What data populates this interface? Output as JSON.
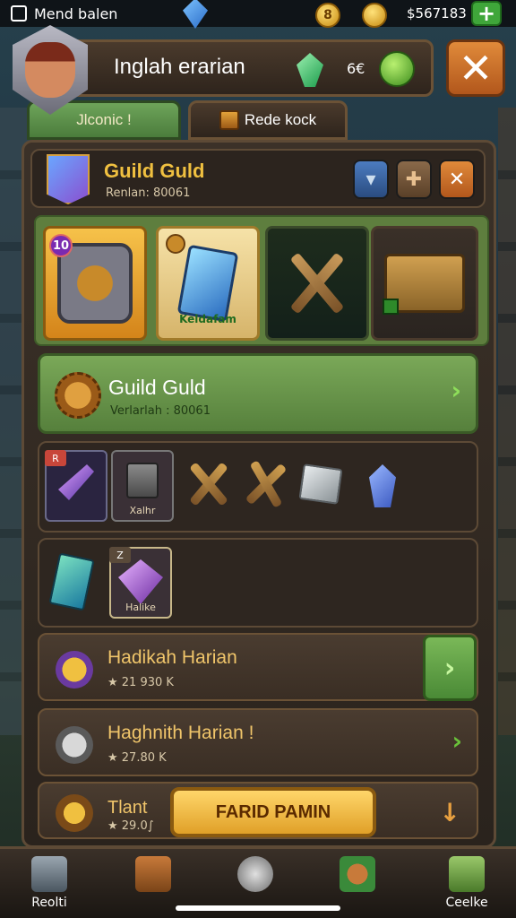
{
  "status_bar": {
    "app_name": "Mend balen",
    "coin_label": "8",
    "money": "$567183"
  },
  "header": {
    "title": "Inglah erarian",
    "count": "6€"
  },
  "tabs": [
    {
      "label": "Jlconic !"
    },
    {
      "label": "Rede kock"
    }
  ],
  "guild_header": {
    "name": "Guild Guld",
    "subtitle": "Renlan: 80061"
  },
  "cards": [
    {
      "icon": "shield-icon",
      "badge": "10"
    },
    {
      "icon": "blue-card-icon",
      "label": "Keldafam"
    },
    {
      "icon": "crossed-weapons-icon"
    },
    {
      "icon": "crate-icon"
    }
  ],
  "guild_bar": {
    "name": "Guild Guld",
    "subtitle": "Verlarlah : 80061"
  },
  "item_row_1": {
    "tag": "R",
    "slot2_label": "Xalhr"
  },
  "item_row_2": {
    "slot2_tag": "Z",
    "slot2_label": "Halike"
  },
  "quests": [
    {
      "name": "Hadikah Harian",
      "sub": "★ 21 930 K"
    },
    {
      "name": "Haghnith Harian !",
      "sub": "★ 27.80 K"
    },
    {
      "name": "Tlant",
      "sub": "★ 29.0∫"
    }
  ],
  "action_button": "FARID PAMIN",
  "nav": [
    {
      "label": "Reolti"
    },
    {
      "label": ""
    },
    {
      "label": ""
    },
    {
      "label": ""
    },
    {
      "label": "Ceelke"
    }
  ],
  "colors": {
    "accent_gold": "#f0c040",
    "accent_green": "#6ea45a",
    "panel_brown": "#3b3128",
    "close_orange": "#e08a3a"
  }
}
